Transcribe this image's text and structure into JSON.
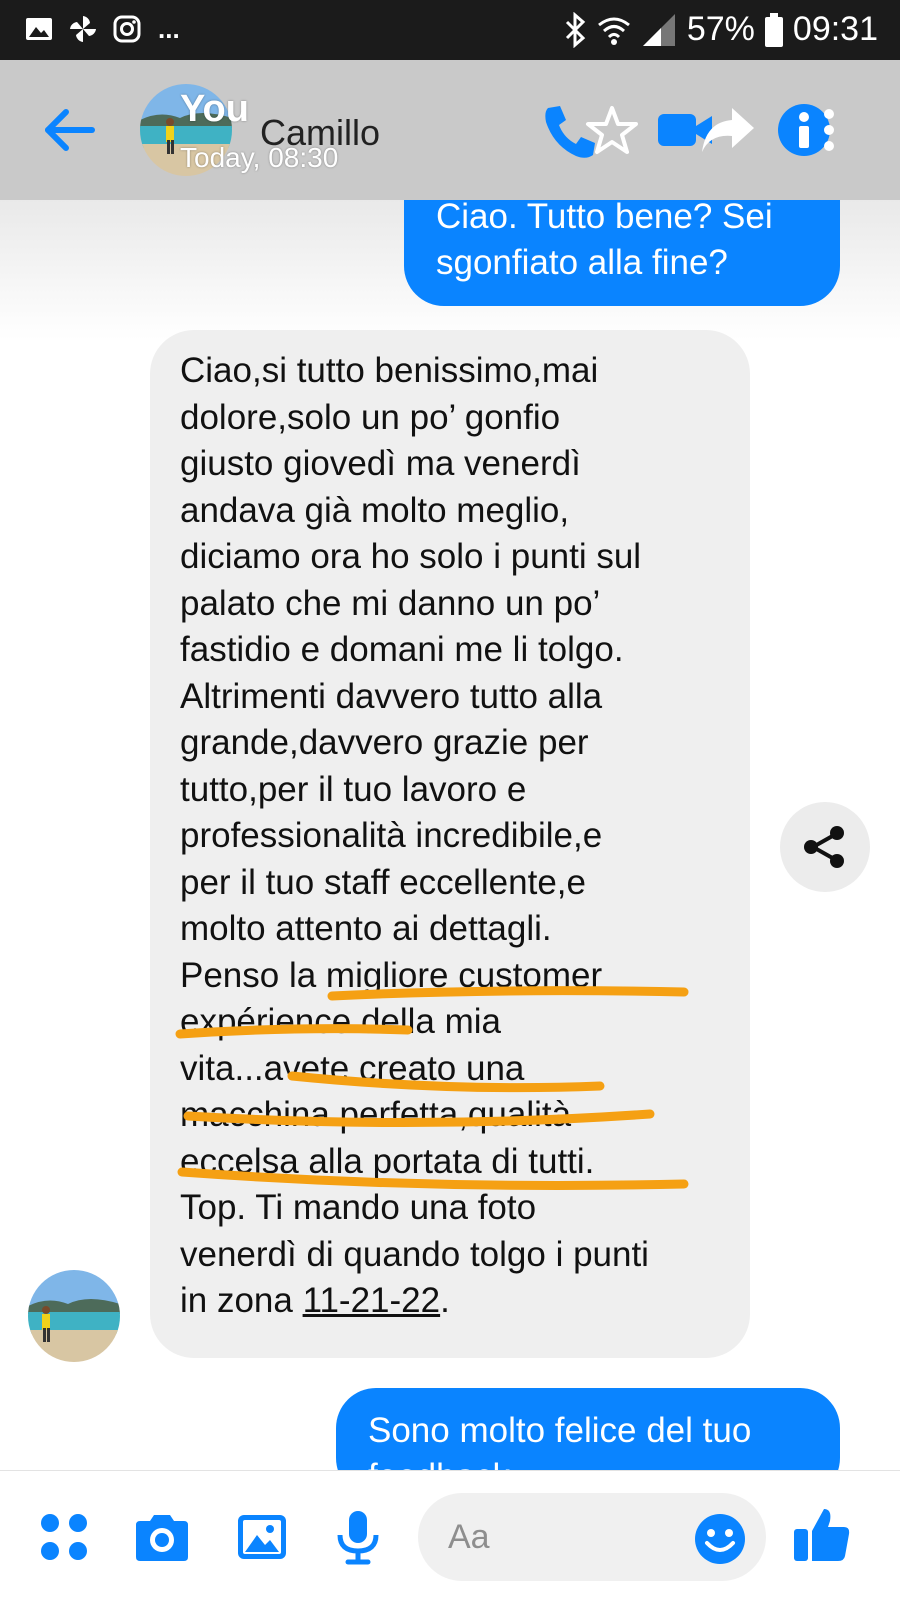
{
  "status_bar": {
    "battery": "57%",
    "time": "09:31",
    "left_icons": [
      "gallery-notification-icon",
      "pinwheel-app-icon",
      "instagram-icon",
      "more-notifications"
    ],
    "right_icons": [
      "bluetooth-icon",
      "wifi-icon",
      "signal-icon",
      "battery-icon"
    ],
    "more_glyph": "..."
  },
  "header": {
    "overlay_name": "You",
    "contact_name": "Camillo",
    "timestamp": "Today, 08:30",
    "bg_color": "#c9c9c9",
    "accent_color": "#0a84ff",
    "icons": [
      "back-arrow-icon",
      "avatar",
      "phone-icon",
      "star-icon",
      "video-camera-icon",
      "forward-arrow-icon",
      "info-icon",
      "more-vertical-icon"
    ]
  },
  "messages": [
    {
      "direction": "outgoing",
      "lines": [
        "Ciao. Tutto bene? Sei",
        "sgonfiato alla fine?"
      ]
    },
    {
      "direction": "incoming",
      "lines": [
        "Ciao,si tutto benissimo,mai",
        "dolore,solo un po’ gonfio",
        "giusto giovedì ma venerdì",
        "andava già molto meglio,",
        "diciamo ora ho solo i punti sul",
        "palato che mi danno un po’",
        "fastidio e domani me li tolgo.",
        "Altrimenti davvero tutto alla",
        "grande,davvero grazie per",
        "tutto,per il tuo lavoro e",
        "professionalità incredibile,e",
        "per il tuo staff eccellente,e",
        "molto attento ai dettagli.",
        "Penso la migliore customer",
        "expérience della mia",
        "vita...avete creato una",
        "macchina perfetta,qualità",
        "eccelsa alla portata di tutti.",
        "Top. Ti mando una foto",
        "venerdì di quando tolgo i punti"
      ],
      "last_line_prefix": "in zona ",
      "link_text": "11-21-22",
      "last_line_suffix": "."
    },
    {
      "direction": "outgoing",
      "lines": [
        "Sono molto felice del tuo",
        "feedback..."
      ]
    }
  ],
  "annotation": {
    "highlight_color": "#f5a013",
    "underlined_phrases": [
      "migliore customer expérience",
      "avete creato una macchina perfetta,qualità eccelsa alla portata di tutti"
    ]
  },
  "share_button": {
    "icon": "share-icon"
  },
  "composer": {
    "placeholder": "Aa",
    "icons": [
      "apps-grid-icon",
      "camera-icon",
      "gallery-icon",
      "microphone-icon",
      "emoji-icon",
      "thumbs-up-icon"
    ]
  }
}
